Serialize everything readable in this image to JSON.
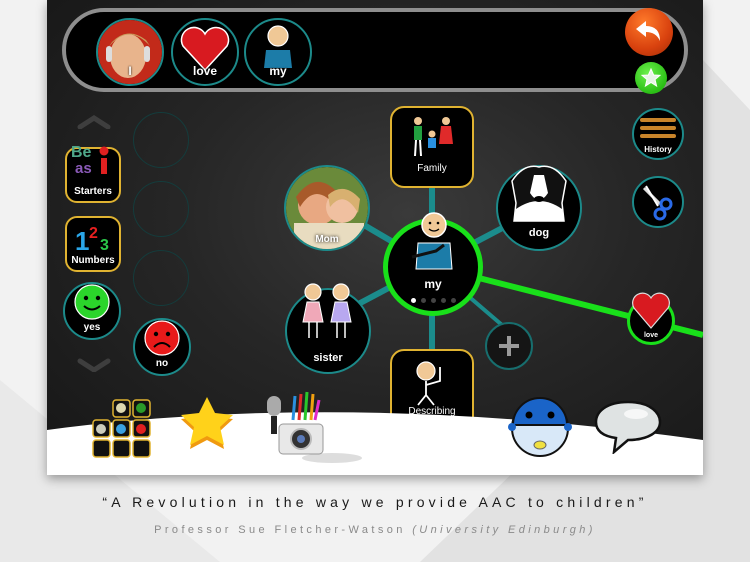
{
  "sentence_bar": {
    "items": [
      {
        "label": "I",
        "icon": "child-photo"
      },
      {
        "label": "love",
        "icon": "heart-icon"
      },
      {
        "label": "my",
        "icon": "my-person-icon"
      }
    ],
    "undo_icon": "undo-arrow-icon",
    "favorite_icon": "star-icon"
  },
  "left_panel": {
    "scroll_up_icon": "chevron-up-icon",
    "scroll_down_icon": "chevron-down-icon",
    "folders": [
      {
        "label": "Starters",
        "icon": "be-a-si-letters-icon"
      },
      {
        "label": "Numbers",
        "icon": "numbers-123-icon"
      }
    ],
    "quick_words": [
      {
        "label": "yes",
        "icon": "happy-face-icon"
      },
      {
        "label": "no",
        "icon": "sad-face-icon"
      }
    ]
  },
  "word_web": {
    "center": {
      "label": "my",
      "page_dots": 5,
      "active_page": 1
    },
    "nodes": [
      {
        "label": "Family",
        "kind": "folder"
      },
      {
        "label": "Mom",
        "kind": "photo"
      },
      {
        "label": "dog",
        "kind": "word"
      },
      {
        "label": "sister",
        "kind": "word"
      },
      {
        "label": "Describing",
        "kind": "folder"
      }
    ],
    "add_icon": "plus-icon",
    "next_word": {
      "label": "love",
      "icon": "heart-icon"
    }
  },
  "right_tools": [
    {
      "label": "History",
      "icon": "history-icon"
    },
    {
      "label": "",
      "icon": "scissors-icon"
    }
  ],
  "dock": [
    {
      "name": "grid-symbols",
      "icon": "symbol-grid-icon"
    },
    {
      "name": "favorites",
      "icon": "star-icon"
    },
    {
      "name": "media",
      "icon": "camera-mic-pencils-icon"
    },
    {
      "name": "robot",
      "icon": "robot-icon"
    },
    {
      "name": "speak",
      "icon": "speech-bubble-icon"
    }
  ],
  "colors": {
    "teal_border": "#1c8a8a",
    "gold_border": "#e0b331",
    "active_green": "#19e01a",
    "undo_orange": "#d8410e"
  },
  "caption": {
    "quote": "“A Revolution in the way we provide AAC to children”",
    "author": "Professor Sue Fletcher-Watson",
    "affiliation": "(University Edinburgh)"
  }
}
